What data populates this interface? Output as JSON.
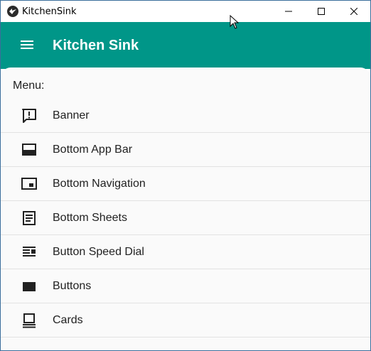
{
  "window": {
    "title": "KitchenSink",
    "controls": [
      "minimize-icon",
      "maximize-icon",
      "close-icon"
    ]
  },
  "appbar": {
    "title": "Kitchen Sink",
    "nav_icon": "menu-icon",
    "background": "#009688"
  },
  "menu": {
    "label": "Menu:",
    "items": [
      {
        "label": "Banner",
        "icon": "alert-box-icon"
      },
      {
        "label": "Bottom App Bar",
        "icon": "bottom-app-bar-icon"
      },
      {
        "label": "Bottom Navigation",
        "icon": "bottom-navigation-icon"
      },
      {
        "label": "Bottom Sheets",
        "icon": "bottom-sheets-icon"
      },
      {
        "label": "Button Speed Dial",
        "icon": "speed-dial-icon"
      },
      {
        "label": "Buttons",
        "icon": "buttons-icon"
      },
      {
        "label": "Cards",
        "icon": "cards-icon"
      }
    ]
  }
}
